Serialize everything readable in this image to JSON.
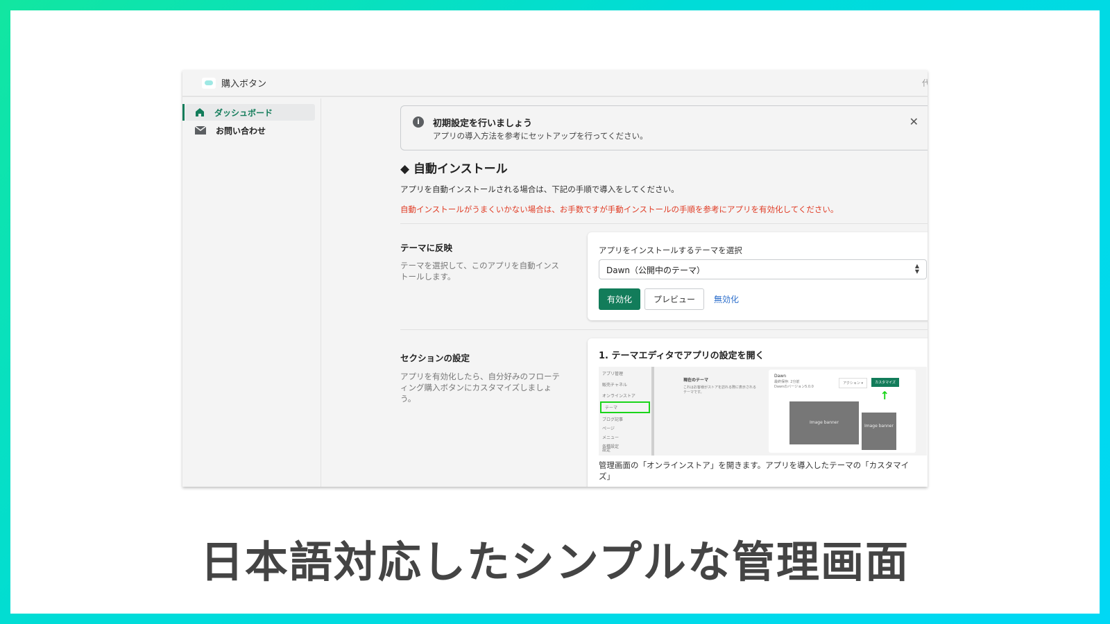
{
  "app": {
    "title": "購入ボタン",
    "header_right": "代"
  },
  "sidebar": {
    "items": [
      {
        "label": "ダッシュボード",
        "icon": "home-icon",
        "active": true
      },
      {
        "label": "お問い合わせ",
        "icon": "mail-icon",
        "active": false
      }
    ]
  },
  "banner": {
    "title": "初期設定を行いましょう",
    "text": "アプリの導入方法を参考にセットアップを行ってください。"
  },
  "auto_install": {
    "heading": "◆ 自動インストール",
    "text": "アプリを自動インストールされる場合は、下記の手順で導入をしてください。",
    "warning": "自動インストールがうまくいかない場合は、お手数ですが手動インストールの手順を参考にアプリを有効化してください。"
  },
  "theme_section": {
    "label": "テーマに反映",
    "description": "テーマを選択して、このアプリを自動インストールします。",
    "select_label": "アプリをインストールするテーマを選択",
    "select_value": "Dawn（公開中のテーマ）",
    "enable": "有効化",
    "preview": "プレビュー",
    "disable": "無効化"
  },
  "section_settings": {
    "label": "セクションの設定",
    "description": "アプリを有効化したら、自分好みのフローティング購入ボタンにカスタマイズしましょう。",
    "step_title": "1. テーマエディタでアプリの設定を開く",
    "step_text": "管理画面の「オンラインストア」を開きます。アプリを導入したテーマの「カスタマイズ」",
    "mini": {
      "app_mgmt": "アプリ管理",
      "channel": "販売チャネル",
      "store": "オンラインストア",
      "nav": [
        "テーマ",
        "ブログ記事",
        "ページ",
        "メニュー",
        "各種設定"
      ],
      "settings": "設定",
      "current_theme": "現在のテーマ",
      "current_desc": "これはお客様がストアを訪れる際に表示されるテーマです。",
      "theme_name": "Dawn",
      "saved": "最終保存: 2分前",
      "version": "Dawnのバージョン5.0.0",
      "actions": "アクション ▾",
      "customize": "カスタマイズ",
      "banner": "Image banner"
    }
  },
  "caption": "日本語対応したシンプルな管理画面",
  "colors": {
    "accent": "#127c5a",
    "warning": "#e03b24",
    "link": "#2c6ecb"
  }
}
